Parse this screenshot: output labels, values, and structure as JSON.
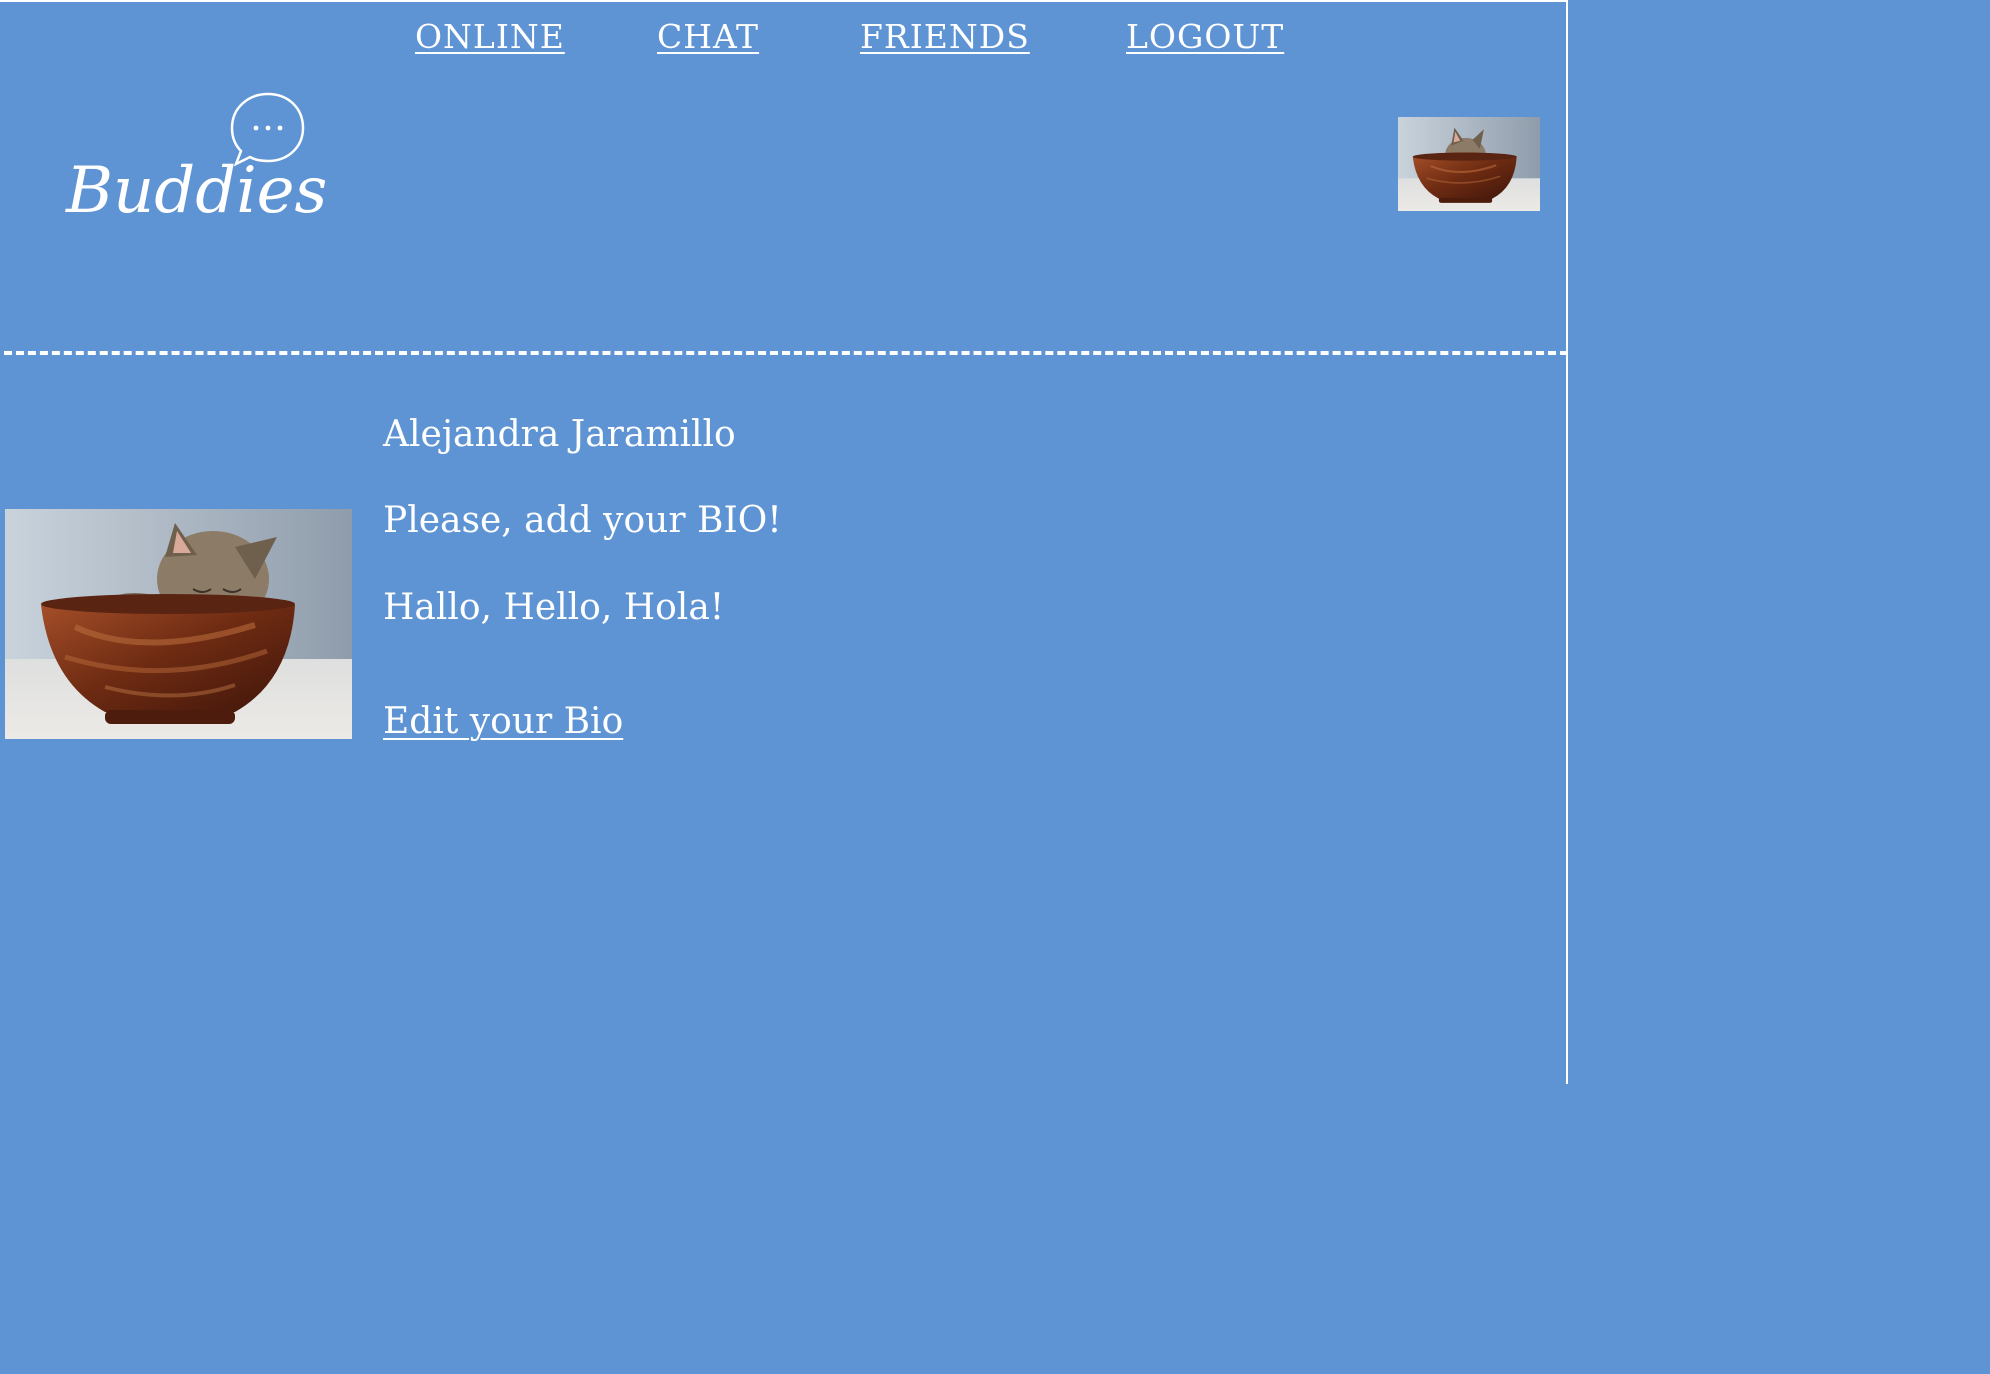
{
  "colors": {
    "background": "#5e94d4",
    "text": "#ffffff"
  },
  "nav": {
    "online": "ONLINE",
    "chat": "CHAT",
    "friends": "FRIENDS",
    "logout": "LOGOUT"
  },
  "logo": {
    "text": "Buddies",
    "bubble_glyph": "..."
  },
  "header": {
    "avatar_icon": "kitten-in-bowl-photo"
  },
  "profile": {
    "name": "Alejandra Jaramillo",
    "bio_prompt": "Please, add your BIO!",
    "bio": "Hallo, Hello, Hola!",
    "edit_link": "Edit your Bio",
    "photo": "kitten-in-bowl-photo"
  }
}
